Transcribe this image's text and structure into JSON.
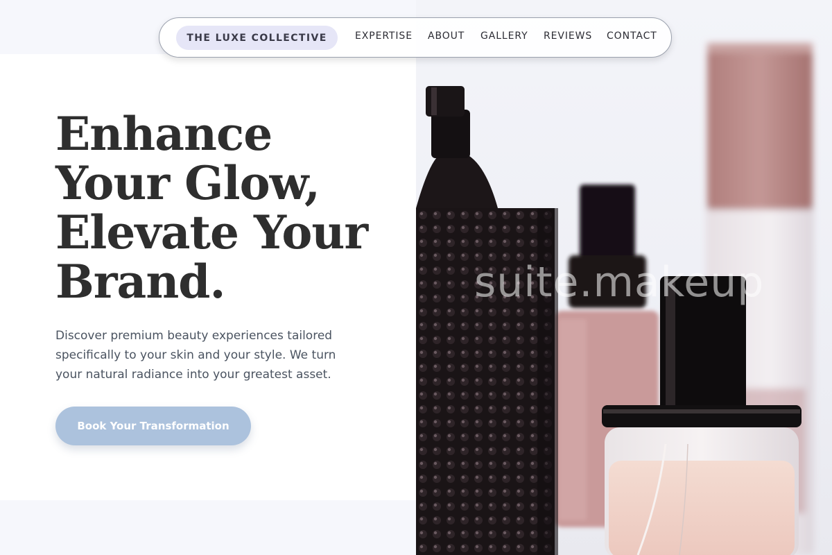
{
  "nav": {
    "brand": "THE LUXE COLLECTIVE",
    "links": [
      "EXPERTISE",
      "ABOUT",
      "GALLERY",
      "REVIEWS",
      "CONTACT"
    ]
  },
  "hero": {
    "headline_lines": [
      "Enhance",
      "Your Glow,",
      "Elevate Your",
      "Brand."
    ],
    "description": "Discover premium beauty experiences tailored specifically to your skin and your style. We turn your natural radiance into your greatest asset.",
    "cta_label": "Book Your Transformation"
  },
  "image": {
    "watermark": "suite.makeup",
    "subject": "perfume-bottles-photo"
  },
  "colors": {
    "background": "#f6f7fc",
    "brand_pill": "#e6e6f7",
    "headline": "#2e2e2e",
    "body_text": "#4a5360",
    "cta": "#acc2dd"
  }
}
